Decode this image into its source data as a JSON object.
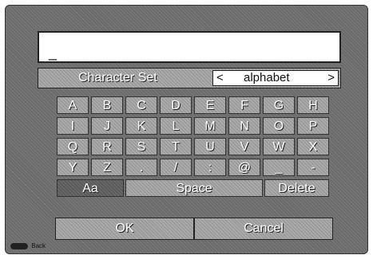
{
  "text_field": {
    "cursor": "_"
  },
  "charset": {
    "label": "Character Set",
    "value": "alphabet",
    "left_arrow": "<",
    "right_arrow": ">"
  },
  "keys": [
    [
      "A",
      "B",
      "C",
      "D",
      "E",
      "F",
      "G",
      "H"
    ],
    [
      "I",
      "J",
      "K",
      "L",
      "M",
      "N",
      "O",
      "P"
    ],
    [
      "Q",
      "R",
      "S",
      "T",
      "U",
      "V",
      "W",
      "X"
    ],
    [
      "Y",
      "Z",
      ".",
      "/",
      ":",
      "@",
      "_",
      "-"
    ]
  ],
  "function_row": {
    "case_label": "Aa",
    "space_label": "Space",
    "delete_label": "Delete"
  },
  "buttons": {
    "ok": "OK",
    "cancel": "Cancel"
  },
  "hint": {
    "back_label": "Back",
    "back_icon": "setup-button-icon"
  }
}
